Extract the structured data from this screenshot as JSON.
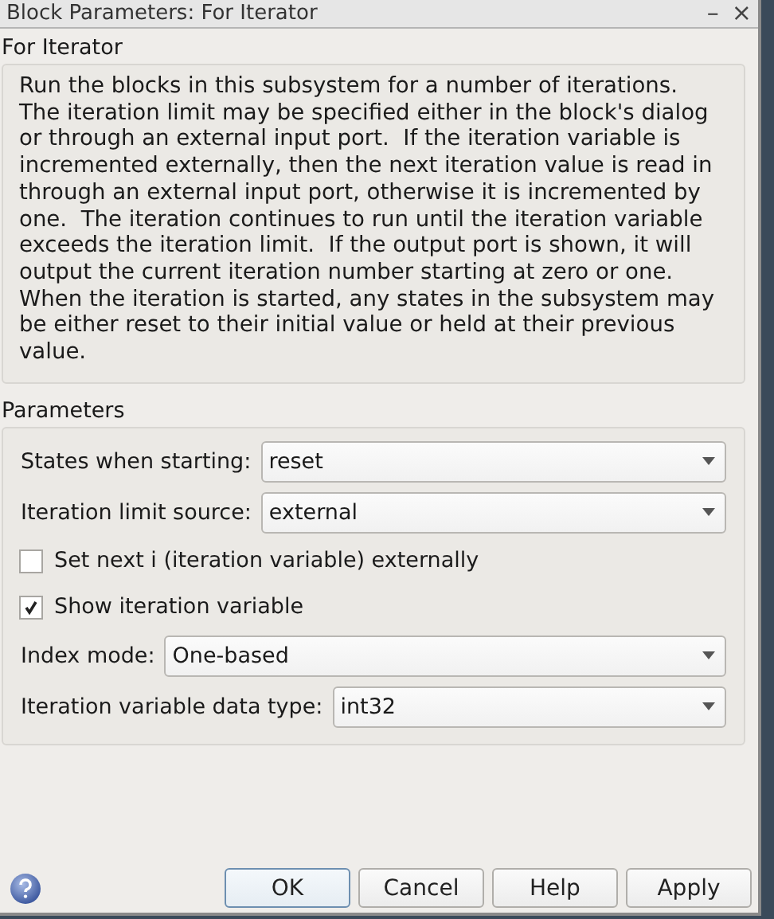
{
  "window": {
    "title": "Block Parameters: For Iterator",
    "minimize": "–",
    "close": "×"
  },
  "block_name": "For Iterator",
  "description": "Run the blocks in this subsystem for a number of iterations.  The iteration limit may be specified either in the block's dialog or through an external input port.  If the iteration variable is incremented externally, then the next iteration value is read in through an external input port, otherwise it is incremented by one.  The iteration continues to run until the iteration variable exceeds the iteration limit.  If the output port is shown, it will output the current iteration number starting at zero or one. When the iteration is started, any states in the subsystem may be either reset to their initial value or held at their previous value.",
  "parameters_title": "Parameters",
  "parameters": [
    {
      "kind": "dropdown",
      "label": "States when starting:",
      "value": "reset"
    },
    {
      "kind": "dropdown",
      "label": "Iteration limit source:",
      "value": "external"
    },
    {
      "kind": "checkbox",
      "label": "Set next i (iteration variable) externally",
      "checked": false
    },
    {
      "kind": "checkbox",
      "label": "Show iteration variable",
      "checked": true
    },
    {
      "kind": "dropdown",
      "label": "Index mode:",
      "value": "One-based"
    },
    {
      "kind": "dropdown",
      "label": "Iteration variable data type:",
      "value": "int32"
    }
  ],
  "buttons": [
    {
      "label": "OK",
      "default": true
    },
    {
      "label": "Cancel",
      "default": false
    },
    {
      "label": "Help",
      "default": false
    },
    {
      "label": "Apply",
      "default": false
    }
  ]
}
